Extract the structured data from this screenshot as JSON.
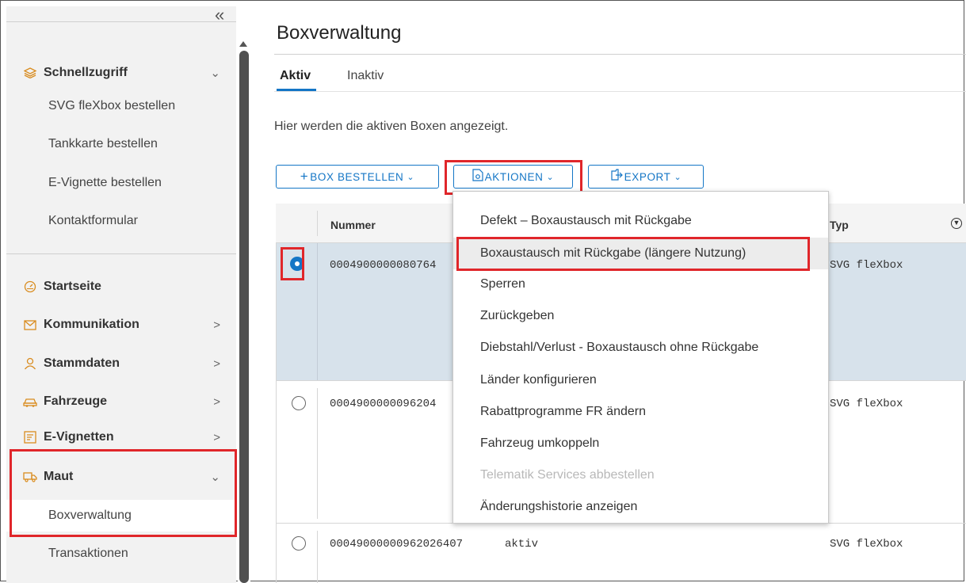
{
  "sidebar": {
    "collapse_glyph": "«",
    "quick_access": {
      "label": "Schnellzugriff",
      "icon": "layers-icon",
      "items": [
        "SVG fleXbox bestellen",
        "Tankkarte bestellen",
        "E-Vignette bestellen",
        "Kontaktformular"
      ]
    },
    "nav": [
      {
        "label": "Startseite",
        "icon": "dashboard-icon"
      },
      {
        "label": "Kommunikation",
        "icon": "mail-icon"
      },
      {
        "label": "Stammdaten",
        "icon": "person-icon"
      },
      {
        "label": "Fahrzeuge",
        "icon": "car-icon"
      },
      {
        "label": "E-Vignetten",
        "icon": "vignette-icon"
      },
      {
        "label": "Maut",
        "icon": "truck-icon"
      }
    ],
    "maut_items": [
      "Boxverwaltung",
      "Transaktionen"
    ]
  },
  "page": {
    "title": "Boxverwaltung",
    "tabs": [
      "Aktiv",
      "Inaktiv"
    ],
    "description": "Hier werden die aktiven Boxen angezeigt."
  },
  "toolbar": {
    "order_label": "BOX BESTELLEN",
    "actions_label": "AKTIONEN",
    "export_label": "EXPORT"
  },
  "table": {
    "columns": {
      "number": "Nummer",
      "type": "Typ"
    },
    "rows": [
      {
        "number": "0004900000080764",
        "status": "",
        "type": "SVG fleXbox",
        "selected": true
      },
      {
        "number": "0004900000096204",
        "status": "",
        "type": "SVG fleXbox",
        "selected": false
      },
      {
        "number": "00049000000962026407",
        "status": "aktiv",
        "type": "SVG fleXbox",
        "selected": false
      }
    ]
  },
  "actions_menu": [
    {
      "label": "Defekt – Boxaustausch mit Rückgabe",
      "state": "normal"
    },
    {
      "label": "Boxaustausch mit Rückgabe (längere Nutzung)",
      "state": "hover"
    },
    {
      "label": "Sperren",
      "state": "normal"
    },
    {
      "label": "Zurückgeben",
      "state": "normal"
    },
    {
      "label": "Diebstahl/Verlust - Boxaustausch ohne Rückgabe",
      "state": "normal"
    },
    {
      "label": "Länder konfigurieren",
      "state": "normal"
    },
    {
      "label": "Rabattprogramme FR ändern",
      "state": "normal"
    },
    {
      "label": "Fahrzeug umkoppeln",
      "state": "normal"
    },
    {
      "label": "Telematik Services abbestellen",
      "state": "disabled"
    },
    {
      "label": "Änderungshistorie anzeigen",
      "state": "normal"
    }
  ],
  "colors": {
    "accent": "#1476c6",
    "highlight": "#e0262a",
    "selected_row": "#d7e2eb",
    "sidebar_bg": "#f2f2f2"
  }
}
